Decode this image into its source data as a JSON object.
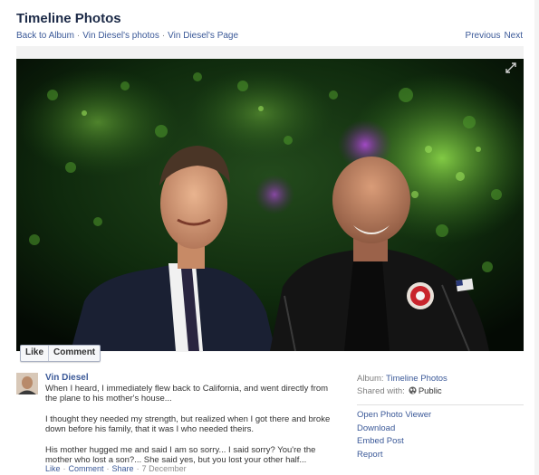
{
  "header": {
    "title": "Timeline Photos",
    "breadcrumbs": [
      "Back to Album",
      "Vin Diesel's photos",
      "Vin Diesel's Page"
    ],
    "separator": "·",
    "previous": "Previous",
    "next": "Next"
  },
  "photo_actions": {
    "like": "Like",
    "comment": "Comment"
  },
  "post": {
    "author": "Vin Diesel",
    "paragraphs": [
      "When I heard, I immediately flew back to California, and went directly from the plane to his mother's house...",
      "I thought they needed my strength, but realized when I got there and broke down before his family, that it was I who needed theirs.",
      "His mother hugged me and said I am so sorry... I said sorry? You're the mother who lost a son?... She said yes, but you lost your other half..."
    ],
    "actions": {
      "like": "Like",
      "comment": "Comment",
      "share": "Share",
      "date": "7 December"
    }
  },
  "sidebar": {
    "album_label": "Album:",
    "album_value": "Timeline Photos",
    "shared_label": "Shared with:",
    "shared_value": "Public",
    "options": [
      "Open Photo Viewer",
      "Download",
      "Embed Post",
      "Report"
    ]
  }
}
